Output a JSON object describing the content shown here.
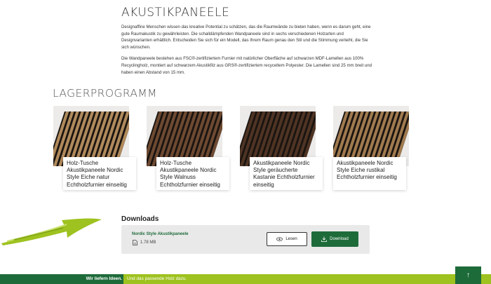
{
  "intro": {
    "title": "AKUSTIKPANEELE",
    "paragraph1": "Designaffine Menschen wissen das kreative Potential zu schätzen, das die Raumwände zu bieten haben, wenn es darum geht, eine gute Raumakustik zu gewährleisten. Die schalldämpfenden Wandpaneele sind in sechs verschiedenen Holzarten und Designvarianten erhältlich. Entscheiden Sie sich für ein Modell, das Ihrem Raum genau den Stil und die Stimmung verleiht, die Sie sich wünschen.",
    "paragraph2": "Die Wandpaneele bestehen aus FSC®-zertifiziertem Furnier mit natürlicher Oberfläche auf schwarzen MDF-Lamellen aus 100% Recyclingholz, montiert auf schwarzem Akustikfilz aus GRS®-zertifiziertem recyceltem Polyester. Die Lamellen sind 25 mm breit und haben einen Abstand von 15 mm."
  },
  "lager": {
    "title": "LAGERPROGRAMM"
  },
  "products": [
    {
      "label": "Holz-Tusche Akustikpaneele Nordic Style Eiche natur Echtholzfurnier einseitig",
      "color": "#b08a5c"
    },
    {
      "label": "Holz-Tusche Akustikpaneele Nordic Style Walnuss Echtholzfurnier einseitig",
      "color": "#6e4a32"
    },
    {
      "label": "Akustikpaneele Nordic Style geräucherte Kastanie Echtholzfurnier einseitig",
      "color": "#4f3424"
    },
    {
      "label": "Akustikpaneele Nordic Style Eiche rustikal Echtholzfurnier einseitig",
      "color": "#a07a4f"
    }
  ],
  "downloads": {
    "title": "Downloads",
    "file_name": "Nordic Style Akustikpaneele",
    "file_size": "1.78 MB",
    "read_label": "Lesen",
    "download_label": "Download"
  },
  "footer": {
    "slogan_bold": "Wir liefern Ideen.",
    "slogan_rest": "Und das passende Holz dazu."
  },
  "colors": {
    "brand_green": "#1e6b3a",
    "lime": "#9ec21f"
  }
}
